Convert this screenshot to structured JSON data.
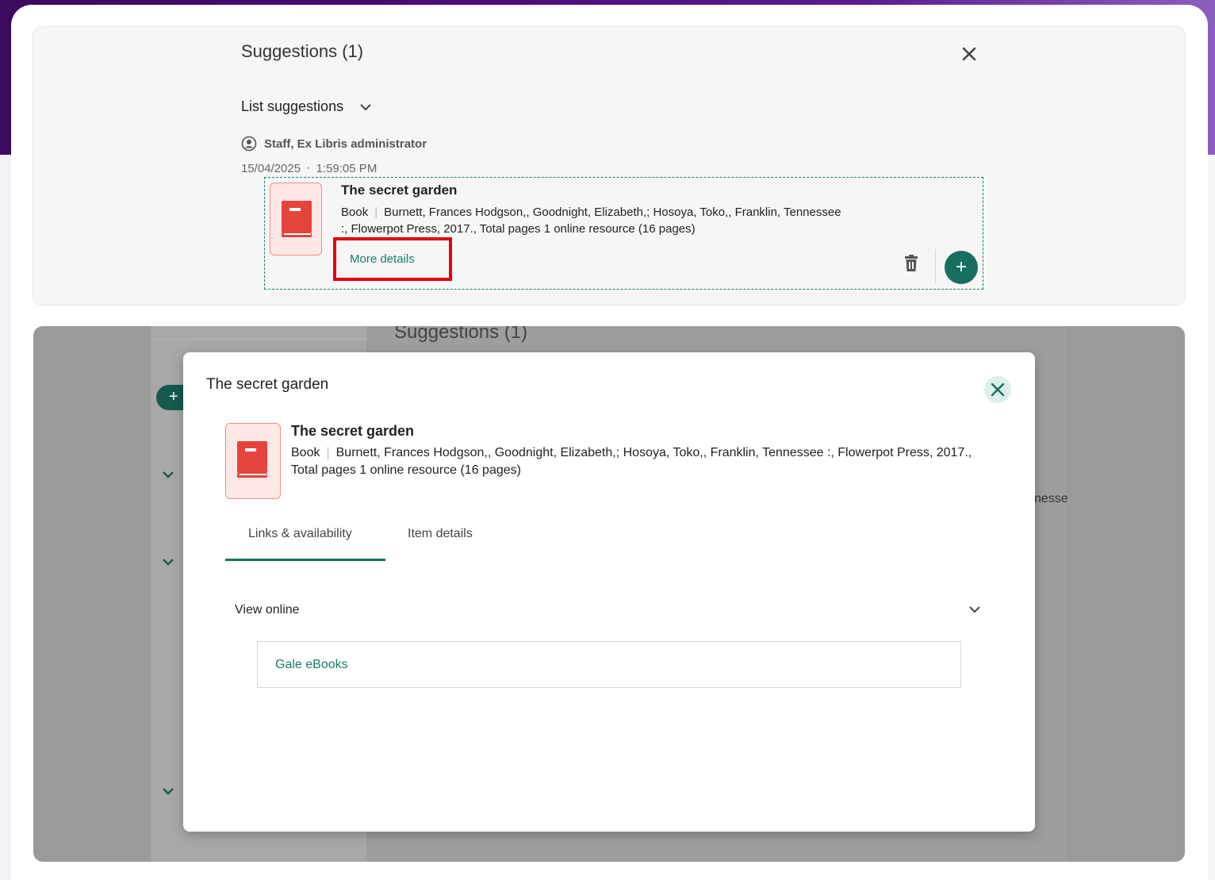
{
  "colors": {
    "accent": "#17705f",
    "link": "#1b7a6a",
    "highlight": "#e5000f",
    "book_icon": "#e4443c"
  },
  "top_panel": {
    "title": "Suggestions (1)",
    "list_label": "List suggestions",
    "user": "Staff, Ex Libris administrator",
    "date": "15/04/2025",
    "time": "1:59:05 PM",
    "suggestion": {
      "title": "The secret garden",
      "type": "Book",
      "details": "Burnett, Frances Hodgson,, Goodnight, Elizabeth,; Hosoya, Toko,, Franklin, Tennessee :, Flowerpot Press, 2017., Total pages 1 online resource (16 pages)",
      "more_details": "More details",
      "add_label": "+"
    }
  },
  "background": {
    "title": "Suggestions (1)",
    "pill": "+",
    "partial_text": "nesse"
  },
  "modal": {
    "title": "The secret garden",
    "book_title": "The secret garden",
    "type": "Book",
    "details": "Burnett, Frances Hodgson,, Goodnight, Elizabeth,; Hosoya, Toko,, Franklin, Tennessee :, Flowerpot Press, 2017., Total pages 1 online resource (16 pages)",
    "tabs": [
      {
        "label": "Links & availability",
        "active": true
      },
      {
        "label": "Item details",
        "active": false
      }
    ],
    "section_label": "View online",
    "link_label": "Gale eBooks"
  }
}
